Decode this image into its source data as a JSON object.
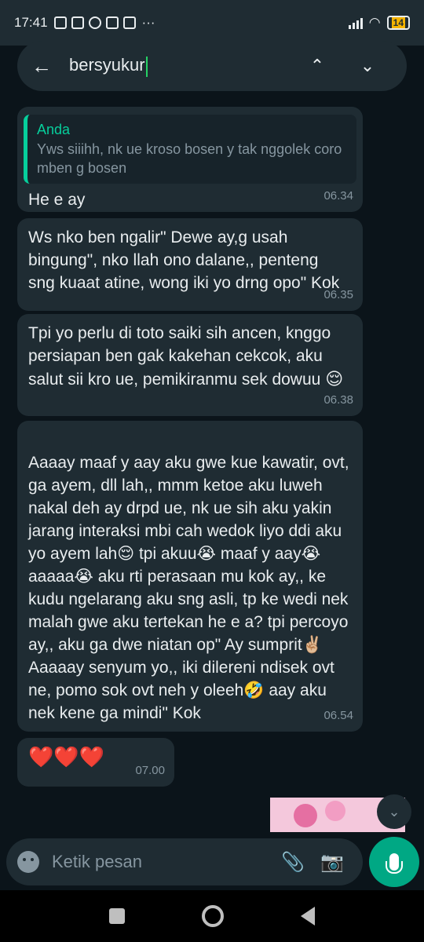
{
  "status_bar": {
    "time": "17:41",
    "battery": "14"
  },
  "search": {
    "query": "bersyukur",
    "back_icon": "arrow-left-icon",
    "up_icon": "chevron-up-icon",
    "down_icon": "chevron-down-icon"
  },
  "messages": [
    {
      "quote_author": "Anda",
      "quote_text": "Yws siiihh, nk ue kroso bosen y tak nggolek coro mben g bosen",
      "text": "He e ay",
      "time": "06.34"
    },
    {
      "text": "Ws nko ben ngalir\" Dewe ay,g usah bingung\", nko llah ono dalane,, penteng sng kuaat atine, wong iki yo drng opo\" Kok",
      "time": "06.35"
    },
    {
      "text": "Tpi yo perlu di toto saiki sih ancen, knggo persiapan ben gak kakehan cekcok, aku salut sii kro ue, pemikiranmu sek dowuu",
      "emoji": "😌",
      "time": "06.38"
    },
    {
      "text": "Aaaay maaf y aay aku gwe kue kawatir, ovt, ga ayem, dll lah,, mmm ketoe aku luweh nakal deh ay drpd ue, nk ue sih aku yakin jarang interaksi mbi cah wedok liyo ddi aku yo ayem lah😌 tpi akuu😭 maaf y aay😭 aaaaa😭  aku rti perasaan mu kok ay,, ke kudu ngelarang aku sng asli, tp ke wedi nek malah gwe aku tertekan he e a? tpi percoyo ay,, aku ga dwe niatan op\" Ay sumprit✌🏼\nAaaaay senyum yo,, iki dilereni ndisek ovt ne, pomo sok ovt neh y oleeh🤣 aay aku nek kene ga mindi\" Kok",
      "time": "06.54"
    },
    {
      "text": "❤️❤️❤️",
      "time": "07.00"
    }
  ],
  "composer": {
    "placeholder": "Ketik pesan"
  },
  "colors": {
    "background": "#0b141a",
    "bubble": "#1f2c33",
    "accent": "#00a884",
    "quote_bar": "#06cf9c"
  }
}
